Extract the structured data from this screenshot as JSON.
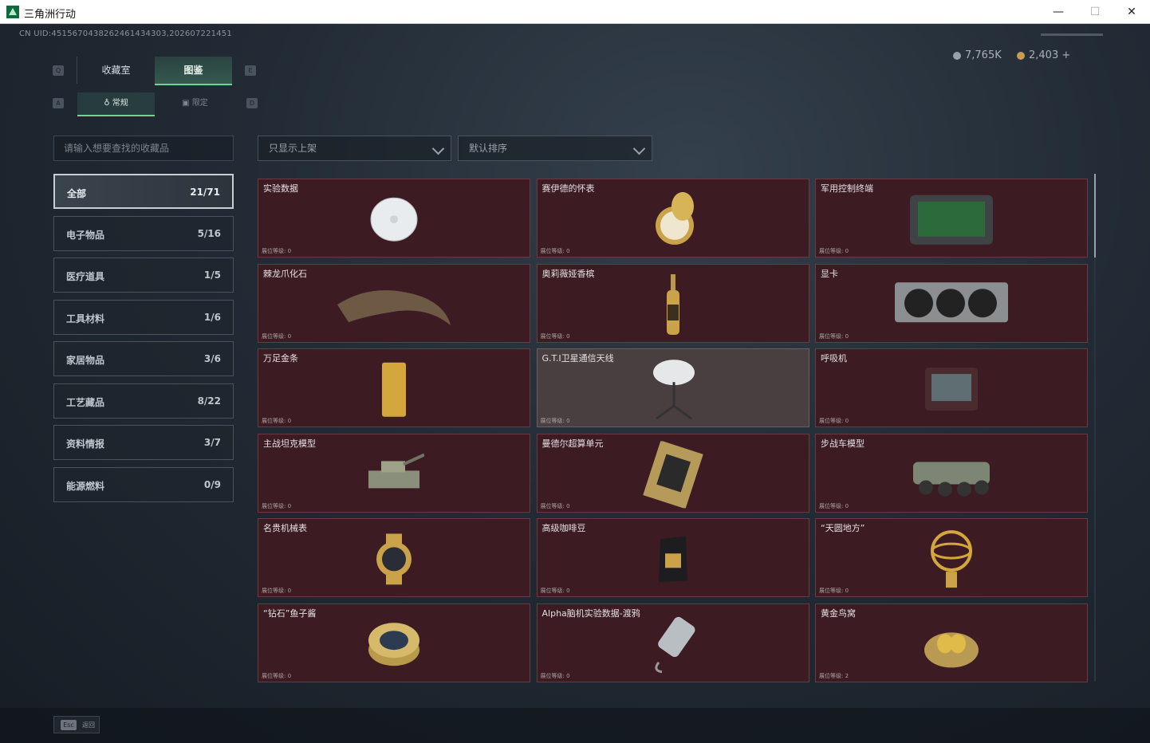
{
  "window": {
    "title": "三角洲行动",
    "minimize": "—",
    "maximize": "☐",
    "close": "✕"
  },
  "uid": "CN UID:4515670438262461434303,202607221451",
  "currency": [
    {
      "value": "7,765K",
      "color": "#9aa0a6"
    },
    {
      "value": "2,403 +",
      "color": "#c89b52"
    }
  ],
  "keyhints": {
    "q": "Q",
    "e": "E",
    "a": "A",
    "d": "D"
  },
  "tabs": [
    {
      "label": "收藏室",
      "active": false
    },
    {
      "label": "图鉴",
      "active": true
    }
  ],
  "subtabs": [
    {
      "label": "常规",
      "icon": "wrench-icon",
      "active": true
    },
    {
      "label": "限定",
      "icon": "badge-icon",
      "active": false
    }
  ],
  "search": {
    "placeholder": "请输入想要查找的收藏品"
  },
  "filters": {
    "shelf": "只显示上架",
    "sort": "默认排序"
  },
  "categories": [
    {
      "label": "全部",
      "count": "21/71",
      "active": true
    },
    {
      "label": "电子物品",
      "count": "5/16",
      "active": false
    },
    {
      "label": "医疗道具",
      "count": "1/5",
      "active": false
    },
    {
      "label": "工具材料",
      "count": "1/6",
      "active": false
    },
    {
      "label": "家居物品",
      "count": "3/6",
      "active": false
    },
    {
      "label": "工艺藏品",
      "count": "8/22",
      "active": false
    },
    {
      "label": "资料情报",
      "count": "3/7",
      "active": false
    },
    {
      "label": "能源燃料",
      "count": "0/9",
      "active": false
    }
  ],
  "items": [
    {
      "name": "实验数据",
      "level": "展位等级: 0",
      "icon": "disc-icon",
      "style": "red"
    },
    {
      "name": "赛伊德的怀表",
      "level": "展位等级: 0",
      "icon": "pocket-watch-icon",
      "style": "red"
    },
    {
      "name": "军用控制终端",
      "level": "展位等级: 0",
      "icon": "control-terminal-icon",
      "style": "red"
    },
    {
      "name": "棘龙爪化石",
      "level": "展位等级: 0",
      "icon": "claw-fossil-icon",
      "style": "red"
    },
    {
      "name": "奥莉薇娅香槟",
      "level": "展位等级: 0",
      "icon": "champagne-icon",
      "style": "red"
    },
    {
      "name": "显卡",
      "level": "展位等级: 0",
      "icon": "graphics-card-icon",
      "style": "red"
    },
    {
      "name": "万足金条",
      "level": "展位等级: 0",
      "icon": "gold-bar-icon",
      "style": "red"
    },
    {
      "name": "G.T.I卫星通信天线",
      "level": "展位等级: 0",
      "icon": "satellite-dish-icon",
      "style": "gray"
    },
    {
      "name": "呼吸机",
      "level": "展位等级: 0",
      "icon": "ventilator-icon",
      "style": "red"
    },
    {
      "name": "主战坦克模型",
      "level": "展位等级: 0",
      "icon": "tank-icon",
      "style": "red"
    },
    {
      "name": "曼德尔超算单元",
      "level": "展位等级: 0",
      "icon": "compute-unit-icon",
      "style": "red"
    },
    {
      "name": "步战车模型",
      "level": "展位等级: 0",
      "icon": "apc-icon",
      "style": "red"
    },
    {
      "name": "名贵机械表",
      "level": "展位等级: 0",
      "icon": "wristwatch-icon",
      "style": "red"
    },
    {
      "name": "高级咖啡豆",
      "level": "展位等级: 0",
      "icon": "coffee-bag-icon",
      "style": "red"
    },
    {
      "name": "“天圆地方”",
      "level": "展位等级: 0",
      "icon": "armillary-sphere-icon",
      "style": "red"
    },
    {
      "name": "“钻石”鱼子酱",
      "level": "展位等级: 0",
      "icon": "caviar-tin-icon",
      "style": "red"
    },
    {
      "name": "Alpha脑机实验数据-渡鸦",
      "level": "展位等级: 0",
      "icon": "data-canister-icon",
      "style": "red"
    },
    {
      "name": "黄金鸟窝",
      "level": "展位等级: 2",
      "icon": "golden-nest-icon",
      "style": "red"
    }
  ],
  "footer": {
    "esc_key": "Esc",
    "esc_label": "返回"
  }
}
